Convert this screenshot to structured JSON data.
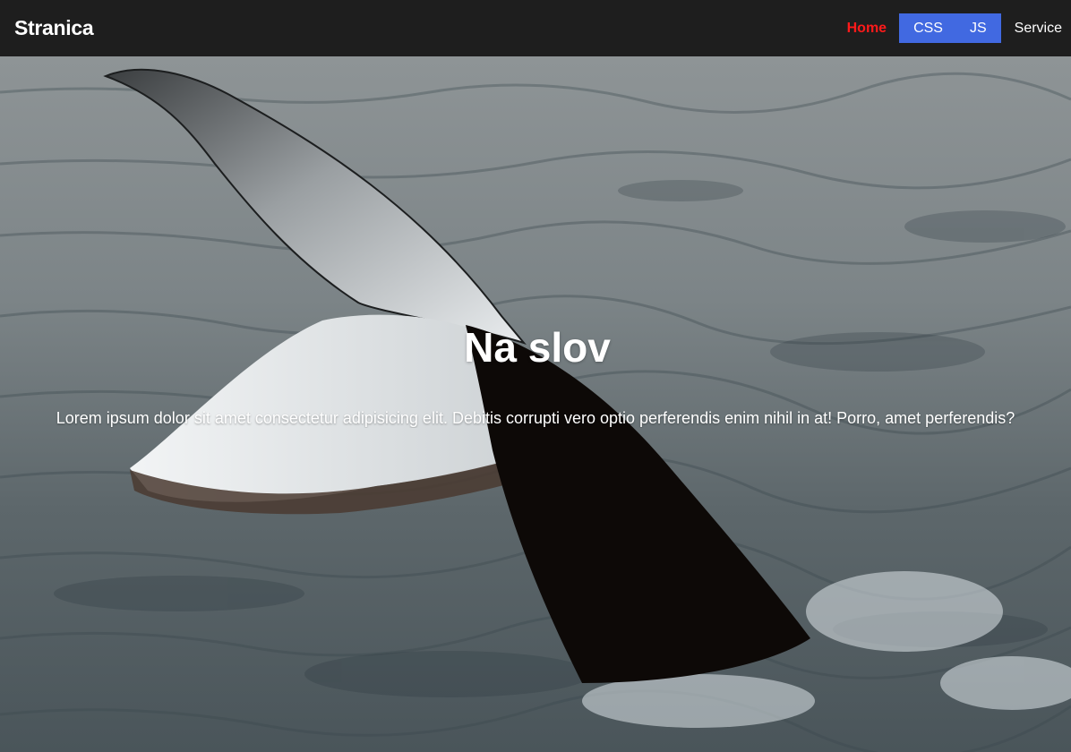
{
  "navbar": {
    "brand": "Stranica",
    "links": [
      {
        "label": "Home"
      },
      {
        "label": "CSS"
      },
      {
        "label": "JS"
      },
      {
        "label": "Service"
      }
    ]
  },
  "hero": {
    "title": "Na slov",
    "text": "Lorem ipsum dolor sit amet consectetur adipisicing elit. Debitis corrupti vero optio perferendis enim nihil in at! Porro, amet perferendis?"
  },
  "colors": {
    "navbar_bg": "#1e1e1e",
    "active_link": "#ff1a1a",
    "link_group_bg": "#4169e1",
    "text": "#ffffff"
  }
}
